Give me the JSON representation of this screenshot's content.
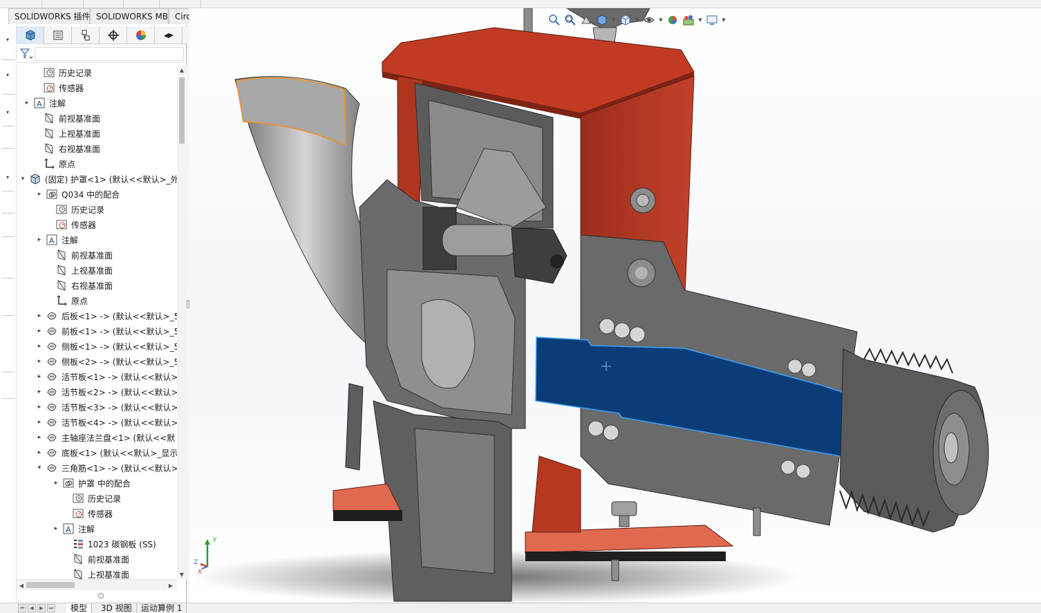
{
  "ribbon": {
    "tabs": [
      {
        "label": "SOLIDWORKS 插件"
      },
      {
        "label": "SOLIDWORKS MBD"
      },
      {
        "label": "CircuitWorks"
      }
    ]
  },
  "view_toolbar": {
    "icons": [
      "zoom-to-fit-icon",
      "zoom-to-area-icon",
      "previous-view-icon",
      "section-view-icon",
      "view-orientation-icon",
      "display-style-icon",
      "hide-show-items-icon",
      "edit-appearance-icon",
      "apply-scene-icon",
      "view-settings-icon"
    ]
  },
  "panel": {
    "tabs": [
      "featuremanager-tab",
      "propertymanager-tab",
      "configurationmanager-tab",
      "dimxpertmanager-tab",
      "displaymanager-tab",
      "cam-tab"
    ],
    "filter_icon": "filter-icon"
  },
  "tree": {
    "nodes": [
      {
        "label": "历史记录",
        "icon": "history-icon",
        "expander": ""
      },
      {
        "label": "传感器",
        "icon": "sensor-icon",
        "expander": ""
      },
      {
        "label": "注解",
        "icon": "annotation-icon",
        "expander": "▸"
      },
      {
        "label": "前视基准面",
        "icon": "plane-icon",
        "expander": ""
      },
      {
        "label": "上视基准面",
        "icon": "plane-icon",
        "expander": ""
      },
      {
        "label": "右视基准面",
        "icon": "plane-icon",
        "expander": ""
      },
      {
        "label": "原点",
        "icon": "origin-icon",
        "expander": ""
      },
      {
        "label": "(固定) 护罩<1> (默认<<默认>_外",
        "icon": "assembly-icon",
        "expander": "▾"
      },
      {
        "label": "Q034 中的配合",
        "icon": "mates-icon",
        "expander": "▸"
      },
      {
        "label": "历史记录",
        "icon": "history-icon",
        "expander": ""
      },
      {
        "label": "传感器",
        "icon": "sensor-icon",
        "expander": ""
      },
      {
        "label": "注解",
        "icon": "annotation-icon",
        "expander": "▸"
      },
      {
        "label": "前视基准面",
        "icon": "plane-icon",
        "expander": ""
      },
      {
        "label": "上视基准面",
        "icon": "plane-icon",
        "expander": ""
      },
      {
        "label": "右视基准面",
        "icon": "plane-icon",
        "expander": ""
      },
      {
        "label": "原点",
        "icon": "origin-icon",
        "expander": ""
      },
      {
        "label": "后板<1> -> (默认<<默认>_5",
        "icon": "part-icon",
        "expander": "▸"
      },
      {
        "label": "前板<1> -> (默认<<默认>_5",
        "icon": "part-icon",
        "expander": "▸"
      },
      {
        "label": "侧板<1> -> (默认<<默认>_5",
        "icon": "part-icon",
        "expander": "▸"
      },
      {
        "label": "侧板<2> -> (默认<<默认>_5",
        "icon": "part-icon",
        "expander": "▸"
      },
      {
        "label": "活节板<1> -> (默认<<默认>",
        "icon": "part-icon",
        "expander": "▸"
      },
      {
        "label": "活节板<2> -> (默认<<默认>",
        "icon": "part-icon",
        "expander": "▸"
      },
      {
        "label": "活节板<3> -> (默认<<默认>",
        "icon": "part-icon",
        "expander": "▸"
      },
      {
        "label": "活节板<4> -> (默认<<默认>",
        "icon": "part-icon",
        "expander": "▸"
      },
      {
        "label": "主轴座法兰盘<1> (默认<<默",
        "icon": "part-icon",
        "expander": "▸"
      },
      {
        "label": "底板<1> (默认<<默认>_显示",
        "icon": "part-icon",
        "expander": "▸"
      },
      {
        "label": "三角筋<1> -> (默认<<默认>",
        "icon": "part-icon",
        "expander": "▾"
      },
      {
        "label": "护罩 中的配合",
        "icon": "mates-icon",
        "expander": "▸"
      },
      {
        "label": "历史记录",
        "icon": "history-icon",
        "expander": ""
      },
      {
        "label": "传感器",
        "icon": "sensor-icon",
        "expander": ""
      },
      {
        "label": "注解",
        "icon": "annotation-icon",
        "expander": "▸"
      },
      {
        "label": "1023 碳钢板 (SS)",
        "icon": "material-icon",
        "expander": ""
      },
      {
        "label": "前视基准面",
        "icon": "plane-icon",
        "expander": ""
      },
      {
        "label": "上视基准面",
        "icon": "plane-icon",
        "expander": ""
      }
    ]
  },
  "triad": {
    "x": "X",
    "y": "Y",
    "z": "Z"
  },
  "bottom_tabs": [
    {
      "label": "模型"
    },
    {
      "label": "3D 视图"
    },
    {
      "label": "运动算例 1"
    }
  ],
  "colors": {
    "housing_red": "#a8321f",
    "housing_red_light": "#c94a2c",
    "steel_gray": "#5e5e5e",
    "shaft_blue": "#0a3d78",
    "selection_orange": "#f0902a"
  }
}
